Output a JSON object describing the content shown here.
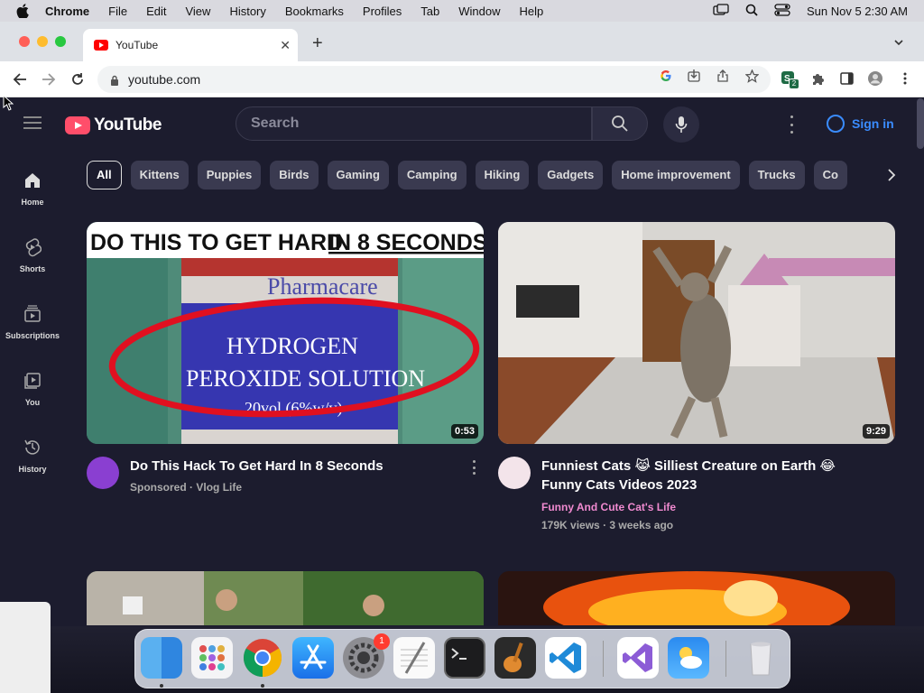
{
  "menubar": {
    "app": "Chrome",
    "items": [
      "File",
      "Edit",
      "View",
      "History",
      "Bookmarks",
      "Profiles",
      "Tab",
      "Window",
      "Help"
    ],
    "datetime": "Sun Nov 5  2:30 AM"
  },
  "tab": {
    "title": "YouTube",
    "close": "✕",
    "new_tab": "+"
  },
  "address": {
    "url": "youtube.com"
  },
  "extensions": {
    "badge_count": "2"
  },
  "youtube": {
    "logo_text": "YouTube",
    "search_placeholder": "Search",
    "sign_in": "Sign in",
    "nav": [
      {
        "label": "Home",
        "icon": "home-icon"
      },
      {
        "label": "Shorts",
        "icon": "shorts-icon"
      },
      {
        "label": "Subscriptions",
        "icon": "subscriptions-icon"
      },
      {
        "label": "You",
        "icon": "library-icon"
      },
      {
        "label": "History",
        "icon": "history-icon"
      }
    ],
    "chips": [
      "All",
      "Kittens",
      "Puppies",
      "Birds",
      "Gaming",
      "Camping",
      "Hiking",
      "Gadgets",
      "Home improvement",
      "Trucks",
      "Co"
    ],
    "videos": [
      {
        "thumb_headline_1": "DO THIS TO GET HARD ",
        "thumb_headline_2": "IN 8 SECONDS",
        "thumb_bottle_brand": "Pharmacare",
        "thumb_bottle_line1": "HYDROGEN",
        "thumb_bottle_line2": "PEROXIDE SOLUTION",
        "thumb_bottle_line3": "20vol (6%w/v)",
        "duration": "0:53",
        "title": "Do This Hack To Get Hard In 8 Seconds",
        "meta_1": "Sponsored",
        "meta_sep": "·",
        "meta_2": "Vlog Life"
      },
      {
        "duration": "9:29",
        "title": "Funniest Cats 😹 Silliest Creature on Earth 😂 Funny Cats Videos 2023",
        "channel": "Funny And Cute Cat's Life",
        "views": "179K views",
        "meta_sep": "·",
        "age": "3 weeks ago"
      }
    ]
  },
  "dock": {
    "apps": [
      "Finder",
      "Launchpad",
      "Google Chrome",
      "App Store",
      "System Settings",
      "TextEdit",
      "Terminal",
      "GarageBand",
      "Visual Studio Code",
      "Visual Studio",
      "Weather",
      "Trash"
    ],
    "settings_badge": "1"
  }
}
